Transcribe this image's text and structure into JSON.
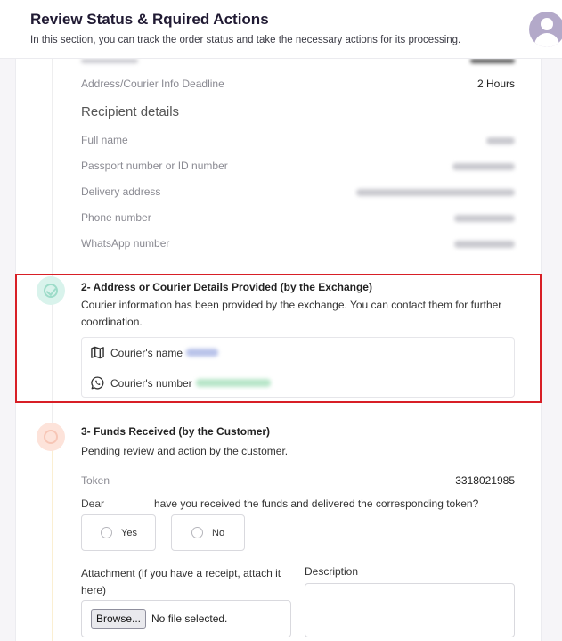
{
  "header": {
    "title": "Review Status & Rquired Actions",
    "subtitle": "In this section, you can track the order status and take the necessary actions for its processing."
  },
  "order_info": {
    "deadline_label": "Address/Courier Info Deadline",
    "deadline_value": "2 Hours"
  },
  "recipient": {
    "heading": "Recipient details",
    "fields": [
      {
        "label": "Full name"
      },
      {
        "label": "Passport number or ID number"
      },
      {
        "label": "Delivery address"
      },
      {
        "label": "Phone number"
      },
      {
        "label": "WhatsApp number"
      }
    ]
  },
  "step2": {
    "title": "2- Address or Courier Details Provided (by the Exchange)",
    "description": "Courier information has been provided by the exchange. You can contact them for further coordination.",
    "courier_name_label": "Courier's name",
    "courier_number_label": "Courier's number",
    "name_icon": "map-icon",
    "number_icon": "whatsapp-icon"
  },
  "step3": {
    "title": "3- Funds Received (by the Customer)",
    "description": "Pending review and action by the customer.",
    "token_label": "Token",
    "token_value": "3318021985",
    "dear_label": "Dear",
    "question": "have you received the funds and delivered the corresponding token?",
    "yes_label": "Yes",
    "no_label": "No",
    "attachment_label": "Attachment (if you have a receipt, attach it here)",
    "description_label": "Description",
    "browse_label": "Browse...",
    "file_status": "No file selected."
  },
  "colors": {
    "highlight": "#d81f26",
    "step_done": "#d9f3ec",
    "step_pending": "#fde3da"
  }
}
